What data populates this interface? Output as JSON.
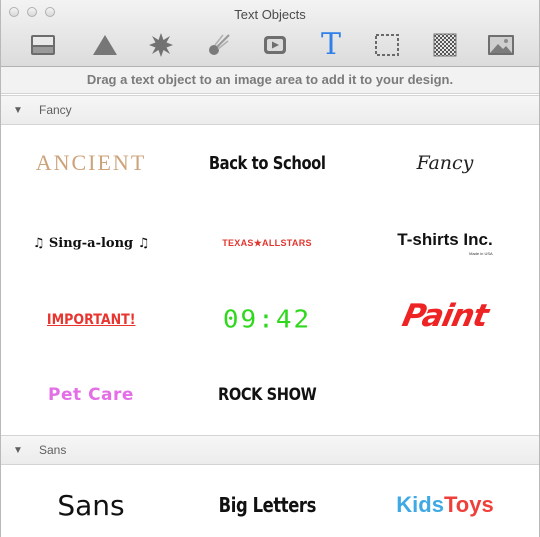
{
  "window": {
    "title": "Text Objects"
  },
  "toolbar": {
    "tools": [
      {
        "icon": "backgrounds-icon",
        "selected": false
      },
      {
        "icon": "shapes-icon",
        "selected": false
      },
      {
        "icon": "burst-icon",
        "selected": false
      },
      {
        "icon": "comet-icon",
        "selected": false
      },
      {
        "icon": "media-play-icon",
        "selected": false
      },
      {
        "icon": "text-icon",
        "selected": true
      },
      {
        "icon": "frame-icon",
        "selected": false
      },
      {
        "icon": "pattern-icon",
        "selected": false
      },
      {
        "icon": "image-icon",
        "selected": false
      }
    ],
    "text_glyph": "T",
    "accent_color": "#2f80e8"
  },
  "hint": "Drag a text object to an image area to add it to your design.",
  "sections": [
    {
      "label": "Fancy",
      "items": [
        "ANCIENT",
        "Back to School",
        "Fancy",
        "♫ Sing-a-long ♫",
        "TEXAS★ALLSTARS",
        "T-shirts Inc.",
        "IMPORTANT!",
        "09:42",
        "Paint",
        "Pet Care",
        "ROCK SHOW"
      ],
      "tshirts_tagline": "Made in USA"
    },
    {
      "label": "Sans",
      "items": [
        "Sans",
        "Big Letters",
        "Kids",
        "Toys"
      ]
    }
  ],
  "collapse_glyph": "▼",
  "colors": {
    "ancient": "#cda37b",
    "red": "#e8352f",
    "clock_green": "#2fd81c",
    "pet_care_pink": "#e36ee6",
    "kids_blue": "#3fa9e6",
    "toys_red": "#ef3f3a"
  }
}
